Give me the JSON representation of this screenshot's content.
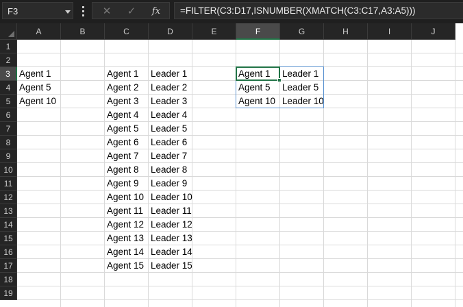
{
  "formula_bar": {
    "name_box": "F3",
    "cancel_glyph": "✕",
    "enter_glyph": "✓",
    "function_glyph": "fx",
    "formula": "=FILTER(C3:D17,ISNUMBER(XMATCH(C3:C17,A3:A5)))"
  },
  "columns": [
    "A",
    "B",
    "C",
    "D",
    "E",
    "F",
    "G",
    "H",
    "I",
    "J"
  ],
  "rows": [
    "1",
    "2",
    "3",
    "4",
    "5",
    "6",
    "7",
    "8",
    "9",
    "10",
    "11",
    "12",
    "13",
    "14",
    "15",
    "16",
    "17",
    "18",
    "19"
  ],
  "selected": {
    "column": "F",
    "row": "3"
  },
  "lookup_list": [
    "Agent 1",
    "Agent 5",
    "Agent 10"
  ],
  "source_table": [
    [
      "Agent 1",
      "Leader 1"
    ],
    [
      "Agent 2",
      "Leader 2"
    ],
    [
      "Agent 3",
      "Leader 3"
    ],
    [
      "Agent 4",
      "Leader 4"
    ],
    [
      "Agent 5",
      "Leader 5"
    ],
    [
      "Agent 6",
      "Leader 6"
    ],
    [
      "Agent 7",
      "Leader 7"
    ],
    [
      "Agent 8",
      "Leader 8"
    ],
    [
      "Agent 9",
      "Leader 9"
    ],
    [
      "Agent 10",
      "Leader 10"
    ],
    [
      "Agent 11",
      "Leader 11"
    ],
    [
      "Agent 12",
      "Leader 12"
    ],
    [
      "Agent 13",
      "Leader 13"
    ],
    [
      "Agent 14",
      "Leader 14"
    ],
    [
      "Agent 15",
      "Leader 15"
    ]
  ],
  "filter_result": [
    [
      "Agent 1",
      "Leader 1"
    ],
    [
      "Agent 5",
      "Leader 5"
    ],
    [
      "Agent 10",
      "Leader 10"
    ]
  ]
}
